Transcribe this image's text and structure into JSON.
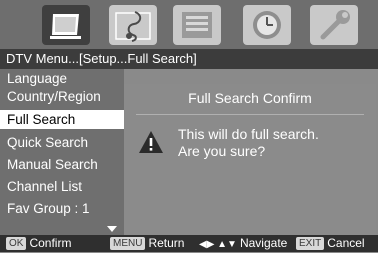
{
  "icons": [
    {
      "name": "screen-icon",
      "active": true
    },
    {
      "name": "music-note-icon",
      "active": false
    },
    {
      "name": "channel-list-icon",
      "active": false
    },
    {
      "name": "clock-icon",
      "active": false
    },
    {
      "name": "wrench-icon",
      "active": false
    }
  ],
  "breadcrumb": "DTV Menu...[Setup...Full Search]",
  "menu": {
    "items": [
      {
        "label": "Language"
      },
      {
        "label": "Country/Region"
      },
      {
        "label": "Full Search",
        "selected": true
      },
      {
        "label": "Quick Search"
      },
      {
        "label": "Manual Search"
      },
      {
        "label": "Channel List"
      },
      {
        "label": "Fav Group : 1"
      }
    ]
  },
  "dialog": {
    "title": "Full Search Confirm",
    "message_line1": "This will do full search.",
    "message_line2": "Are you sure?"
  },
  "help": {
    "ok_key": "OK",
    "ok_label": "Confirm",
    "menu_key": "MENU",
    "menu_label": "Return",
    "nav_label": "Navigate",
    "exit_key": "EXIT",
    "exit_label": "Cancel"
  },
  "colors": {
    "background": "#8a8a8a",
    "selected_item": "#ffffff",
    "active_tile": "#3f3f3f",
    "inactive_tile": "#c9c9c9"
  }
}
